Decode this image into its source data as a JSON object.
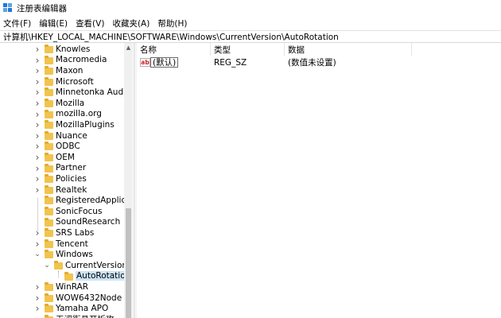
{
  "window": {
    "title": "注册表编辑器"
  },
  "menu": [
    {
      "label": "文件(F)"
    },
    {
      "label": "编辑(E)"
    },
    {
      "label": "查看(V)"
    },
    {
      "label": "收藏夹(A)"
    },
    {
      "label": "帮助(H)"
    }
  ],
  "address": {
    "path": "计算机\\HKEY_LOCAL_MACHINE\\SOFTWARE\\Windows\\CurrentVersion\\AutoRotation"
  },
  "tree": {
    "items": [
      {
        "label": "Knowles",
        "expander": "chevron-right",
        "depth": 0
      },
      {
        "label": "Macromedia",
        "expander": "chevron-right",
        "depth": 0
      },
      {
        "label": "Maxon",
        "expander": "chevron-right",
        "depth": 0
      },
      {
        "label": "Microsoft",
        "expander": "chevron-right",
        "depth": 0
      },
      {
        "label": "Minnetonka Audio",
        "expander": "chevron-right",
        "depth": 0
      },
      {
        "label": "Mozilla",
        "expander": "chevron-right",
        "depth": 0
      },
      {
        "label": "mozilla.org",
        "expander": "chevron-right",
        "depth": 0
      },
      {
        "label": "MozillaPlugins",
        "expander": "chevron-right",
        "depth": 0
      },
      {
        "label": "Nuance",
        "expander": "chevron-right",
        "depth": 0
      },
      {
        "label": "ODBC",
        "expander": "chevron-right",
        "depth": 0
      },
      {
        "label": "OEM",
        "expander": "chevron-right",
        "depth": 0
      },
      {
        "label": "Partner",
        "expander": "chevron-right",
        "depth": 0
      },
      {
        "label": "Policies",
        "expander": "chevron-right",
        "depth": 0
      },
      {
        "label": "Realtek",
        "expander": "chevron-right",
        "depth": 0
      },
      {
        "label": "RegisteredApplications",
        "expander": "none",
        "depth": 0
      },
      {
        "label": "SonicFocus",
        "expander": "none",
        "depth": 0
      },
      {
        "label": "SoundResearch",
        "expander": "none",
        "depth": 0
      },
      {
        "label": "SRS Labs",
        "expander": "chevron-right",
        "depth": 0
      },
      {
        "label": "Tencent",
        "expander": "chevron-right",
        "depth": 0
      },
      {
        "label": "Windows",
        "expander": "chevron-down",
        "depth": 0
      },
      {
        "label": "CurrentVersion",
        "expander": "chevron-down",
        "depth": 1
      },
      {
        "label": "AutoRotation",
        "expander": "none",
        "depth": 2,
        "selected": true
      },
      {
        "label": "WinRAR",
        "expander": "chevron-right",
        "depth": 0
      },
      {
        "label": "WOW6432Node",
        "expander": "chevron-right",
        "depth": 0
      },
      {
        "label": "Yamaha APO",
        "expander": "chevron-right",
        "depth": 0
      },
      {
        "label": "无涩街县开拆攻",
        "expander": "chevron-right",
        "depth": 0
      }
    ]
  },
  "values": {
    "columns": [
      {
        "label": "名称"
      },
      {
        "label": "类型"
      },
      {
        "label": "数据"
      }
    ],
    "rows": [
      {
        "icon": "ab",
        "name": "(默认)",
        "type": "REG_SZ",
        "data": "(数值未设置)"
      }
    ]
  },
  "colors": {
    "folder": "#f1c44e",
    "selection": "#cce4f7",
    "app_icon": "#1f7ad6",
    "string_icon": "#d21f1f"
  }
}
